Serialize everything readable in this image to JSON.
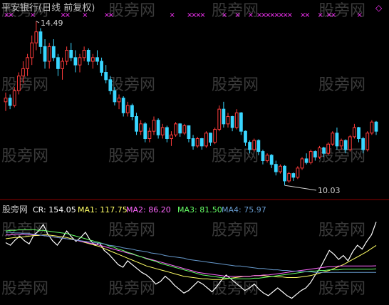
{
  "header": {
    "title": "平安银行(日线 前复权)",
    "title_color": "#c0c0c0"
  },
  "watermark": {
    "text": "股旁网",
    "color": "#3a3a3a"
  },
  "price_panel": {
    "high_label": "14.49",
    "low_label": "10.03",
    "up_color": "#ff3b3b",
    "down_color": "#39d6ff",
    "marker_color": "#ff33ff",
    "marker_symbol": "×",
    "corner_symbol": "◇"
  },
  "indicator_panel": {
    "source": "股旁网",
    "legend": [
      {
        "label": "CR:",
        "value": "154.05",
        "color": "#ffffff"
      },
      {
        "label": "MA1:",
        "value": "117.75",
        "color": "#ffff66"
      },
      {
        "label": "MA2:",
        "value": "86.20",
        "color": "#ff66ff"
      },
      {
        "label": "MA3:",
        "value": "81.50",
        "color": "#66ff66"
      },
      {
        "label": "MA4:",
        "value": "75.97",
        "color": "#6699cc"
      }
    ]
  },
  "chart_data": [
    {
      "type": "candlestick",
      "series_name": "平安银行(日线 前复权)",
      "annotations": {
        "max": 14.49,
        "min": 10.03
      },
      "ohlc": [
        [
          12.3,
          12.55,
          12.05,
          12.4
        ],
        [
          12.4,
          12.5,
          12.1,
          12.2
        ],
        [
          12.2,
          12.7,
          12.15,
          12.6
        ],
        [
          12.6,
          13.1,
          12.5,
          13.0
        ],
        [
          13.0,
          13.4,
          12.8,
          13.2
        ],
        [
          13.2,
          13.6,
          13.0,
          13.5
        ],
        [
          13.5,
          14.1,
          13.3,
          13.9
        ],
        [
          13.9,
          14.49,
          13.7,
          14.2
        ],
        [
          14.2,
          14.3,
          13.6,
          13.8
        ],
        [
          13.8,
          14.0,
          13.2,
          13.4
        ],
        [
          13.4,
          13.9,
          13.2,
          13.8
        ],
        [
          13.8,
          14.0,
          13.4,
          13.5
        ],
        [
          13.5,
          13.6,
          13.0,
          13.2
        ],
        [
          13.2,
          13.5,
          12.9,
          13.4
        ],
        [
          13.4,
          13.8,
          13.3,
          13.7
        ],
        [
          13.7,
          13.9,
          13.4,
          13.5
        ],
        [
          13.5,
          13.7,
          13.1,
          13.3
        ],
        [
          13.3,
          13.6,
          13.1,
          13.5
        ],
        [
          13.5,
          13.8,
          13.4,
          13.7
        ],
        [
          13.7,
          13.75,
          13.3,
          13.4
        ],
        [
          13.4,
          13.6,
          13.2,
          13.5
        ],
        [
          13.5,
          13.7,
          13.3,
          13.4
        ],
        [
          13.4,
          13.5,
          13.0,
          13.1
        ],
        [
          13.1,
          13.3,
          12.8,
          12.9
        ],
        [
          12.9,
          13.0,
          12.5,
          12.6
        ],
        [
          12.6,
          12.7,
          12.2,
          12.3
        ],
        [
          12.3,
          12.5,
          12.1,
          12.4
        ],
        [
          12.4,
          12.45,
          11.9,
          12.0
        ],
        [
          12.0,
          12.3,
          11.9,
          12.2
        ],
        [
          12.2,
          12.25,
          11.8,
          11.9
        ],
        [
          11.9,
          12.0,
          11.4,
          11.5
        ],
        [
          11.5,
          11.8,
          11.4,
          11.7
        ],
        [
          11.7,
          11.75,
          11.2,
          11.3
        ],
        [
          11.3,
          11.6,
          11.2,
          11.5
        ],
        [
          11.5,
          11.9,
          11.4,
          11.8
        ],
        [
          11.8,
          11.85,
          11.3,
          11.4
        ],
        [
          11.4,
          11.7,
          11.3,
          11.6
        ],
        [
          11.6,
          11.65,
          11.2,
          11.3
        ],
        [
          11.3,
          11.5,
          11.1,
          11.4
        ],
        [
          11.4,
          11.75,
          11.35,
          11.7
        ],
        [
          11.7,
          11.72,
          11.35,
          11.45
        ],
        [
          11.45,
          11.7,
          11.4,
          11.65
        ],
        [
          11.65,
          11.66,
          11.2,
          11.3
        ],
        [
          11.3,
          11.4,
          11.0,
          11.1
        ],
        [
          11.1,
          11.35,
          11.05,
          11.3
        ],
        [
          11.3,
          11.32,
          11.0,
          11.1
        ],
        [
          11.1,
          11.5,
          11.05,
          11.45
        ],
        [
          11.45,
          11.46,
          11.1,
          11.2
        ],
        [
          11.2,
          11.6,
          11.15,
          11.55
        ],
        [
          11.55,
          12.2,
          11.5,
          12.1
        ],
        [
          12.1,
          12.3,
          11.6,
          11.7
        ],
        [
          11.7,
          12.0,
          11.6,
          11.9
        ],
        [
          11.9,
          11.92,
          11.5,
          11.6
        ],
        [
          11.6,
          12.1,
          11.55,
          12.0
        ],
        [
          12.0,
          12.02,
          11.4,
          11.5
        ],
        [
          11.5,
          11.52,
          11.1,
          11.2
        ],
        [
          11.2,
          11.25,
          10.9,
          11.0
        ],
        [
          11.0,
          11.3,
          10.95,
          11.25
        ],
        [
          11.25,
          11.28,
          10.85,
          10.95
        ],
        [
          10.95,
          11.0,
          10.6,
          10.7
        ],
        [
          10.7,
          10.9,
          10.65,
          10.85
        ],
        [
          10.85,
          10.88,
          10.5,
          10.6
        ],
        [
          10.6,
          10.7,
          10.3,
          10.4
        ],
        [
          10.4,
          10.6,
          10.35,
          10.55
        ],
        [
          10.55,
          10.58,
          10.03,
          10.15
        ],
        [
          10.15,
          10.4,
          10.1,
          10.35
        ],
        [
          10.35,
          10.38,
          10.15,
          10.25
        ],
        [
          10.25,
          10.55,
          10.2,
          10.5
        ],
        [
          10.5,
          10.8,
          10.45,
          10.75
        ],
        [
          10.75,
          10.9,
          10.6,
          10.65
        ],
        [
          10.65,
          11.0,
          10.6,
          10.95
        ],
        [
          10.95,
          10.98,
          10.7,
          10.8
        ],
        [
          10.8,
          11.1,
          10.75,
          11.05
        ],
        [
          11.05,
          11.08,
          10.8,
          10.9
        ],
        [
          10.9,
          11.2,
          10.85,
          11.15
        ],
        [
          11.15,
          11.5,
          11.1,
          11.45
        ],
        [
          11.45,
          11.6,
          11.0,
          11.1
        ],
        [
          11.1,
          11.3,
          11.0,
          11.25
        ],
        [
          11.25,
          11.28,
          10.9,
          11.0
        ],
        [
          11.0,
          11.4,
          10.95,
          11.35
        ],
        [
          11.35,
          11.7,
          11.3,
          11.6
        ],
        [
          11.6,
          11.62,
          11.2,
          11.3
        ],
        [
          11.3,
          11.35,
          10.9,
          11.0
        ],
        [
          11.0,
          11.5,
          10.95,
          11.45
        ],
        [
          11.45,
          11.8,
          11.4,
          11.75
        ],
        [
          11.75,
          11.78,
          11.4,
          11.5
        ]
      ],
      "signal_marks": [
        0,
        1,
        6,
        13,
        14,
        18,
        23,
        24,
        38,
        42,
        43,
        44,
        45,
        50,
        53,
        56,
        58,
        59,
        60,
        61,
        62,
        63,
        64,
        65,
        68,
        69,
        72,
        74,
        75,
        81
      ]
    },
    {
      "type": "line",
      "series": [
        {
          "name": "CR",
          "values": [
            122,
            118,
            126,
            132,
            125,
            120,
            134,
            140,
            150,
            135,
            125,
            118,
            128,
            140,
            131,
            124,
            130,
            138,
            126,
            118,
            122,
            110,
            104,
            96,
            88,
            84,
            94,
            88,
            82,
            76,
            72,
            66,
            58,
            62,
            70,
            64,
            56,
            50,
            44,
            48,
            55,
            62,
            58,
            52,
            46,
            54,
            64,
            72,
            66,
            60,
            54,
            48,
            52,
            58,
            50,
            44,
            40,
            46,
            52,
            46,
            40,
            36,
            42,
            48,
            52,
            60,
            72,
            82,
            96,
            110,
            104,
            96,
            102,
            94,
            108,
            118,
            112,
            124,
            134,
            154
          ]
        },
        {
          "name": "MA1",
          "values": [
            128,
            129,
            130,
            130,
            131,
            132,
            133,
            133,
            134,
            134,
            133,
            132,
            131,
            130,
            128,
            126,
            124,
            122,
            120,
            118,
            116,
            113,
            110,
            107,
            104,
            101,
            98,
            95,
            92,
            89,
            86,
            84,
            82,
            80,
            78,
            76,
            74,
            72,
            70,
            69,
            68,
            67,
            66,
            66,
            65,
            65,
            65,
            66,
            67,
            68,
            69,
            70,
            70,
            71,
            71,
            71,
            70,
            70,
            69,
            69,
            68,
            68,
            68,
            69,
            70,
            71,
            73,
            75,
            77,
            79,
            82,
            85,
            88,
            92,
            96,
            100,
            104,
            108,
            113,
            117.75
          ]
        },
        {
          "name": "MA2",
          "values": [
            134,
            134,
            135,
            135,
            135,
            135,
            134,
            134,
            133,
            132,
            131,
            130,
            129,
            128,
            127,
            126,
            124,
            123,
            121,
            120,
            118,
            116,
            114,
            112,
            110,
            108,
            106,
            104,
            102,
            100,
            98,
            96,
            94,
            92,
            90,
            88,
            86,
            84,
            82,
            80,
            78,
            76,
            75,
            74,
            73,
            72,
            71,
            70,
            70,
            70,
            70,
            70,
            70,
            71,
            71,
            72,
            72,
            73,
            74,
            75,
            76,
            77,
            78,
            79,
            80,
            81,
            82,
            83,
            84,
            85,
            85,
            86,
            86,
            86,
            86,
            86,
            86,
            86,
            86,
            86.2
          ]
        },
        {
          "name": "MA3",
          "values": [
            140,
            141,
            141,
            142,
            142,
            142,
            142,
            141,
            141,
            140,
            139,
            138,
            137,
            136,
            134,
            132,
            130,
            128,
            126,
            124,
            122,
            120,
            117,
            115,
            112,
            110,
            107,
            105,
            102,
            100,
            97,
            95,
            93,
            90,
            88,
            86,
            84,
            82,
            80,
            78,
            76,
            74,
            72,
            71,
            70,
            69,
            68,
            67,
            67,
            66,
            66,
            66,
            66,
            67,
            67,
            68,
            69,
            70,
            71,
            72,
            73,
            74,
            75,
            76,
            77,
            78,
            78,
            79,
            79,
            80,
            80,
            80,
            81,
            81,
            81,
            81,
            81,
            81,
            81,
            81.5
          ]
        },
        {
          "name": "MA4",
          "values": [
            138,
            138,
            137,
            137,
            136,
            136,
            135,
            134,
            133,
            132,
            131,
            130,
            129,
            128,
            127,
            126,
            125,
            124,
            123,
            122,
            121,
            120,
            118,
            117,
            116,
            114,
            113,
            112,
            110,
            109,
            108,
            106,
            105,
            104,
            102,
            101,
            100,
            99,
            98,
            96,
            95,
            94,
            93,
            92,
            91,
            90,
            89,
            88,
            87,
            86,
            86,
            85,
            84,
            83,
            82,
            82,
            81,
            80,
            80,
            79,
            79,
            78,
            78,
            77,
            77,
            77,
            76,
            76,
            76,
            76,
            76,
            76,
            76,
            76,
            76,
            76,
            76,
            76,
            76,
            75.97
          ]
        }
      ]
    }
  ]
}
